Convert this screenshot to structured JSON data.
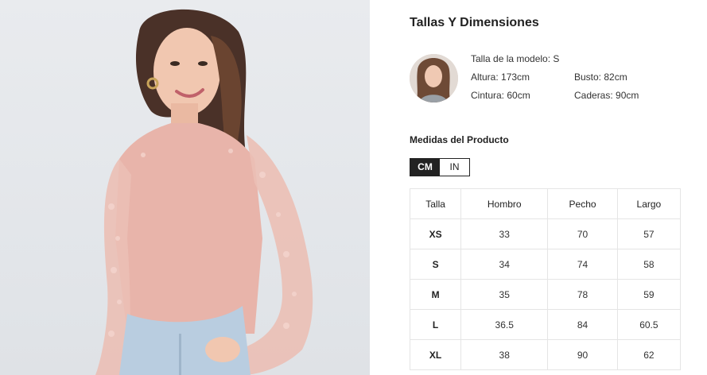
{
  "size_panel": {
    "title": "Tallas Y Dimensiones",
    "model": {
      "size_label": "Talla de la modelo: S",
      "height": "Altura: 173cm",
      "bust": "Busto: 82cm",
      "waist": "Cintura: 60cm",
      "hips": "Caderas: 90cm"
    },
    "product_title": "Medidas del Producto",
    "units": [
      {
        "label": "CM",
        "active": true
      },
      {
        "label": "IN",
        "active": false
      }
    ],
    "table": {
      "headers": [
        "Talla",
        "Hombro",
        "Pecho",
        "Largo"
      ],
      "rows": [
        [
          "XS",
          "33",
          "70",
          "57"
        ],
        [
          "S",
          "34",
          "74",
          "58"
        ],
        [
          "M",
          "35",
          "78",
          "59"
        ],
        [
          "L",
          "36.5",
          "84",
          "60.5"
        ],
        [
          "XL",
          "38",
          "90",
          "62"
        ]
      ]
    }
  },
  "colors": {
    "accent": "#222222",
    "border": "#e5e5e5",
    "garment": "#e8b4aa"
  }
}
